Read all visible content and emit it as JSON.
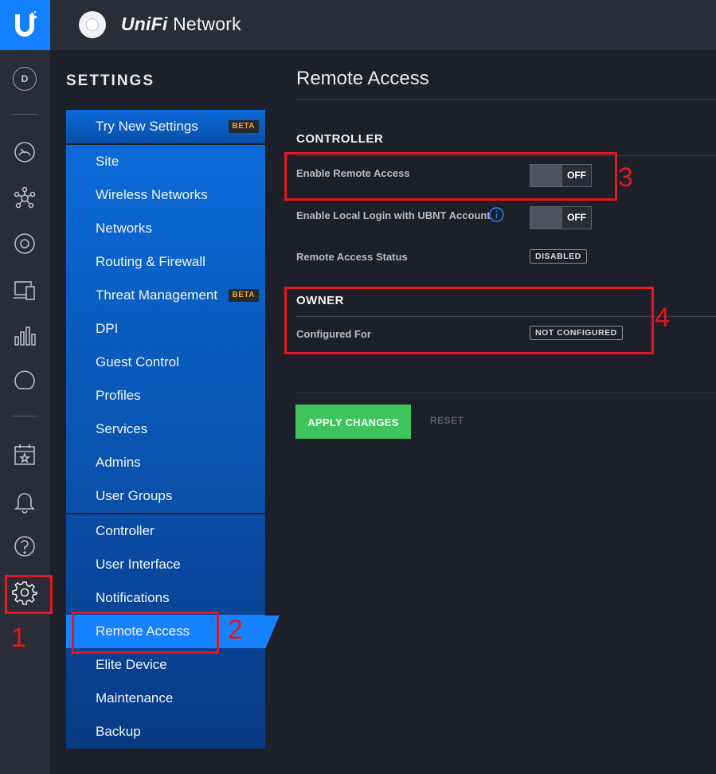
{
  "app": {
    "brand_prefix": "UniFi",
    "brand_suffix": " Network",
    "avatar_letter": "D"
  },
  "rail": {
    "icons": [
      "dashboard-icon",
      "topology-icon",
      "devices-icon",
      "clients-icon",
      "statistics-icon",
      "insights-icon",
      "events-icon",
      "alerts-icon",
      "help-icon",
      "settings-icon"
    ]
  },
  "settings": {
    "title": "SETTINGS",
    "groups": [
      [
        {
          "label": "Try New Settings",
          "badge": "BETA"
        }
      ],
      [
        {
          "label": "Site"
        },
        {
          "label": "Wireless Networks"
        },
        {
          "label": "Networks"
        },
        {
          "label": "Routing & Firewall"
        },
        {
          "label": "Threat Management",
          "badge": "BETA"
        },
        {
          "label": "DPI"
        },
        {
          "label": "Guest Control"
        },
        {
          "label": "Profiles"
        },
        {
          "label": "Services"
        },
        {
          "label": "Admins"
        },
        {
          "label": "User Groups"
        }
      ],
      [
        {
          "label": "Controller"
        },
        {
          "label": "User Interface"
        },
        {
          "label": "Notifications"
        },
        {
          "label": "Remote Access",
          "active": true
        },
        {
          "label": "Elite Device"
        },
        {
          "label": "Maintenance"
        },
        {
          "label": "Backup"
        }
      ]
    ]
  },
  "content": {
    "title": "Remote Access",
    "controller": {
      "heading": "CONTROLLER",
      "enable_remote_access": {
        "label": "Enable Remote Access",
        "state": "OFF"
      },
      "enable_local_login": {
        "label": "Enable Local Login with UBNT Account",
        "state": "OFF"
      },
      "status": {
        "label": "Remote Access Status",
        "value": "DISABLED"
      }
    },
    "owner": {
      "heading": "OWNER",
      "configured_for": {
        "label": "Configured For",
        "value": "NOT CONFIGURED"
      }
    },
    "apply_label": "APPLY CHANGES",
    "reset_label": "RESET"
  },
  "annotations": [
    "1",
    "2",
    "3",
    "4"
  ],
  "colors": {
    "accent": "#1480ff",
    "apply": "#3fc45d",
    "badge_text": "#f0a332",
    "annotation": "#e2171f"
  }
}
